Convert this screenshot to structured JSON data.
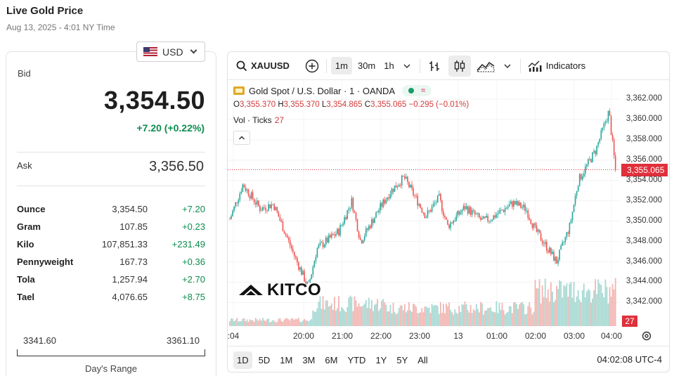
{
  "header": {
    "title": "Live Gold Price",
    "timestamp": "Aug 13, 2025 - 4:01 NY Time"
  },
  "currency_select": {
    "value": "USD",
    "flag_icon": "us-flag-icon"
  },
  "quote": {
    "bid_label": "Bid",
    "bid": "3,354.50",
    "bid_change": "+7.20 (+0.22%)",
    "ask_label": "Ask",
    "ask": "3,356.50"
  },
  "units": [
    {
      "name": "Ounce",
      "price": "3,354.50",
      "change": "+7.20"
    },
    {
      "name": "Gram",
      "price": "107.85",
      "change": "+0.23"
    },
    {
      "name": "Kilo",
      "price": "107,851.33",
      "change": "+231.49"
    },
    {
      "name": "Pennyweight",
      "price": "167.73",
      "change": "+0.36"
    },
    {
      "name": "Tola",
      "price": "1,257.94",
      "change": "+2.70"
    },
    {
      "name": "Tael",
      "price": "4,076.65",
      "change": "+8.75"
    }
  ],
  "days_range": {
    "low": "3341.60",
    "high": "3361.10",
    "label": "Day's Range"
  },
  "chart_toolbar": {
    "symbol": "XAUUSD",
    "intervals": [
      "1m",
      "30m",
      "1h"
    ],
    "active_interval": "1m",
    "indicators_label": "Indicators"
  },
  "chart_legend": {
    "title": "Gold Spot / U.S. Dollar · 1 · OANDA",
    "o_label": "O",
    "o": "3,355.370",
    "h_label": "H",
    "h": "3,355.370",
    "l_label": "L",
    "l": "3,354.865",
    "c_label": "C",
    "c": "3,355.065",
    "change": "−0.295 (−0.01%)",
    "vol_label": "Vol · Ticks",
    "vol_value": "27"
  },
  "current_price_tag": "3,355.065",
  "volume_tag": "27",
  "watermark": "KITCO",
  "range_buttons": [
    "1D",
    "5D",
    "1M",
    "3M",
    "6M",
    "YTD",
    "1Y",
    "5Y",
    "All"
  ],
  "active_range": "1D",
  "clock": "04:02:08 UTC-4",
  "colors": {
    "up": "#26a69a",
    "down": "#ef5350",
    "accent_green": "#0d8c4f",
    "price_tag": "#e0303c"
  },
  "chart_data": {
    "type": "line",
    "title": "Gold Spot / U.S. Dollar · 1 · OANDA",
    "x_ticks": [
      ":04",
      "20:00",
      "21:00",
      "22:00",
      "23:00",
      "13",
      "01:00",
      "02:00",
      "03:00",
      "04:00"
    ],
    "y_ticks": [
      "3,362.000",
      "3,360.000",
      "3,358.000",
      "3,356.000",
      "3,354.000",
      "3,352.000",
      "3,350.000",
      "3,348.000",
      "3,346.000",
      "3,344.000",
      "3,342.000"
    ],
    "ylim": [
      3341.2,
      3362.7
    ],
    "series": [
      {
        "name": "XAUUSD",
        "x": [
          0,
          0.3,
          0.7,
          1.0,
          1.5,
          1.8,
          2.0,
          2.5,
          2.8,
          3.0,
          3.4,
          3.7,
          4.0,
          4.5,
          4.8,
          5.0,
          5.4,
          5.8,
          6.0,
          6.5,
          6.8,
          7.0,
          7.5,
          7.8,
          8.0,
          8.4,
          8.7,
          8.85
        ],
        "values": [
          3350.2,
          3353.6,
          3351.2,
          3351.7,
          3346.4,
          3343.5,
          3347.3,
          3349.0,
          3352.0,
          3348.0,
          3351.0,
          3353.0,
          3354.3,
          3350.5,
          3352.3,
          3349.5,
          3351.4,
          3350.0,
          3350.3,
          3351.8,
          3351.2,
          3349.2,
          3346.0,
          3349.5,
          3354.0,
          3357.0,
          3360.8,
          3355.065
        ]
      }
    ],
    "volume": {
      "name": "Vol · Ticks",
      "last": 27,
      "ylim": [
        0,
        70
      ]
    }
  }
}
